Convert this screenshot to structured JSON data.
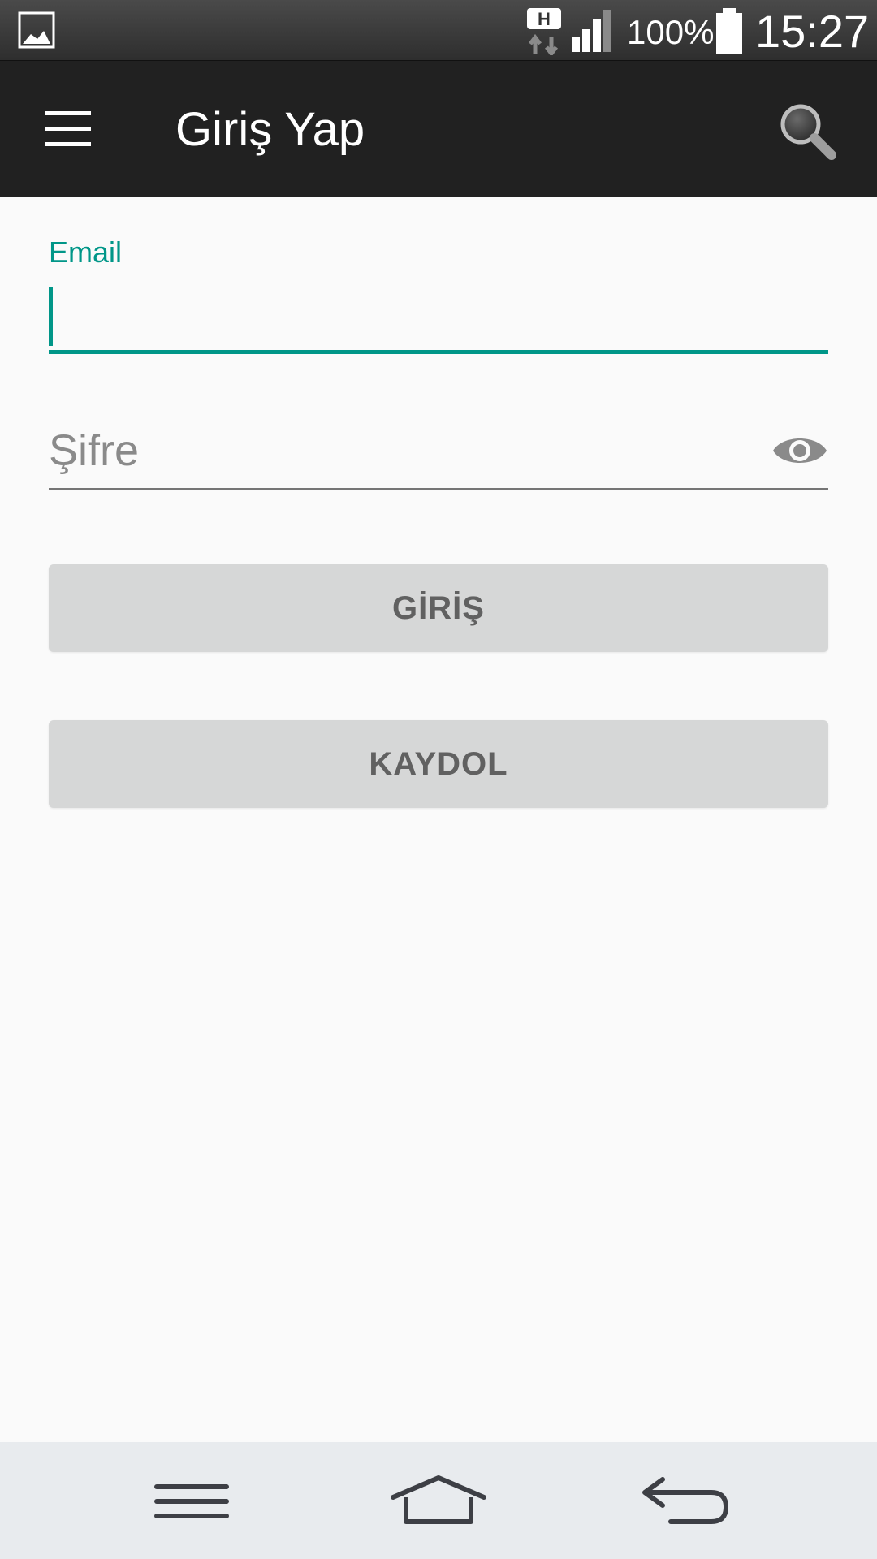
{
  "status_bar": {
    "network_type": "H",
    "battery_percent": "100%",
    "time": "15:27",
    "icons": [
      "gallery-icon",
      "h-network-icon",
      "signal-icon",
      "battery-icon"
    ]
  },
  "app_bar": {
    "title": "Giriş Yap",
    "icons": [
      "menu-icon",
      "search-icon"
    ]
  },
  "form": {
    "email": {
      "label": "Email",
      "value": ""
    },
    "password": {
      "placeholder": "Şifre",
      "value": "",
      "toggle_icon": "eye-icon"
    },
    "login_button": "GİRİŞ",
    "register_button": "KAYDOL"
  },
  "nav_bar": {
    "icons": [
      "menu-icon",
      "home-icon",
      "back-icon"
    ]
  },
  "colors": {
    "accent": "#009688",
    "app_bar": "#212121",
    "background": "#fafafa",
    "button_bg": "#d6d7d7",
    "button_text": "#616161",
    "nav_bar": "#e8ebee"
  }
}
